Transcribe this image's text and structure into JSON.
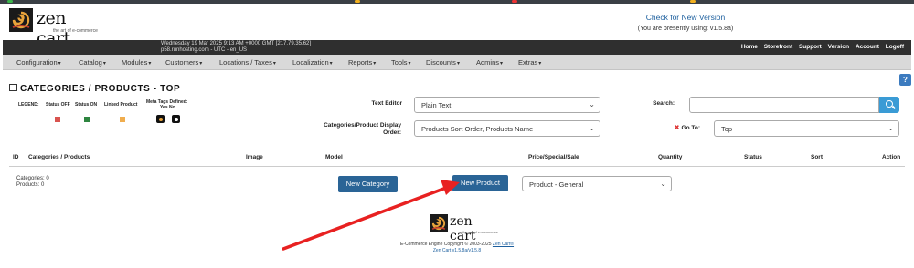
{
  "brand": {
    "name": "zen cart",
    "tagline": "the art of e-commerce"
  },
  "version": {
    "check_link": "Check for New Version",
    "current": "(You are presently using: v1.5.8a)"
  },
  "header": {
    "datetime": "Wednesday 19 Mar 2025 9:13 AM +0000 GMT [217.79.35.62]",
    "host": "p58.runhosting.com - UTC - en_US",
    "links": [
      "Home",
      "Storefront",
      "Support",
      "Version",
      "Account",
      "Logoff"
    ]
  },
  "menu": [
    "Configuration",
    "Catalog",
    "Modules",
    "Customers",
    "Locations / Taxes",
    "Localization",
    "Reports",
    "Tools",
    "Discounts",
    "Admins",
    "Extras"
  ],
  "help": "?",
  "page_title": "Categories / Products - Top",
  "legend": {
    "label": "LEGEND:",
    "status_off": "Status OFF",
    "status_on": "Status ON",
    "linked": "Linked Product",
    "meta": "Meta Tags Defined:",
    "yes_no": "Yes No",
    "colors": {
      "off": "#d9534f",
      "on": "#2e8540",
      "linked": "#f0ad4e"
    }
  },
  "form": {
    "text_editor_label": "Text Editor",
    "text_editor_value": "Plain Text",
    "display_order_label_1": "Categories/Product Display",
    "display_order_label_2": "Order:",
    "display_order_value": "Products Sort Order, Products Name",
    "search_label": "Search:",
    "goto_label": "Go To:",
    "goto_value": "Top"
  },
  "table": {
    "headers": [
      "ID",
      "Categories / Products",
      "Image",
      "Model",
      "Price/Special/Sale",
      "Quantity",
      "Status",
      "Sort",
      "Action"
    ]
  },
  "counts": {
    "categories": "Categories: 0",
    "products": "Products: 0"
  },
  "buttons": {
    "new_category": "New Category",
    "new_product": "New Product"
  },
  "product_type": "Product - General",
  "footer": {
    "copyright": "E-Commerce Engine Copyright © 2003-2025",
    "copyright_link": "Zen Cart®",
    "version_link": "Zen Cart v1.5.8a/v1.5.8"
  }
}
